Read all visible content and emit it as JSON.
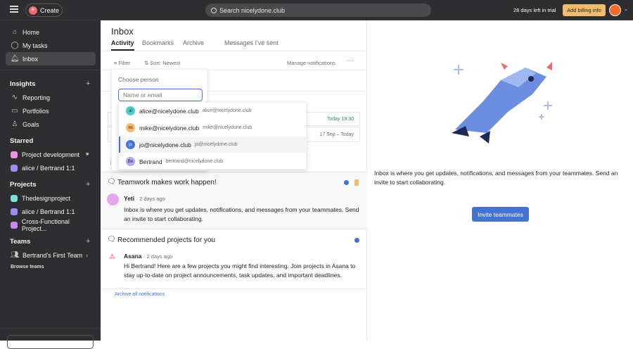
{
  "topbar": {
    "create_label": "Create",
    "search_placeholder": "Search nicelydone.club",
    "trial_text": "28 days left in trial",
    "billing_label": "Add billing info"
  },
  "sidebar": {
    "nav": [
      {
        "label": "Home"
      },
      {
        "label": "My tasks"
      },
      {
        "label": "Inbox"
      }
    ],
    "insights_label": "Insights",
    "insights": [
      {
        "label": "Reporting"
      },
      {
        "label": "Portfolios"
      },
      {
        "label": "Goals"
      }
    ],
    "starred_label": "Starred",
    "starred": [
      {
        "label": "Project development",
        "color": "#f28fe6"
      },
      {
        "label": "alice / Bertrand 1:1",
        "color": "#9f8cf2"
      }
    ],
    "projects_label": "Projects",
    "projects": [
      {
        "label": "Thedesignproject",
        "color": "#7fe0d6"
      },
      {
        "label": "alice / Bertrand 1:1",
        "color": "#9f8cf2"
      },
      {
        "label": "Cross-Functional Project...",
        "color": "#c58bef"
      }
    ],
    "teams_label": "Teams",
    "team": "Bertrand's First Team",
    "browse_teams": "Browse teams"
  },
  "main": {
    "title": "Inbox",
    "tabs": [
      "Activity",
      "Bookmarks",
      "Archive",
      "Messages I've sent"
    ],
    "filter_label": "Filter",
    "sort_label": "Sort: Newest",
    "manage_label": "Manage notifications",
    "task_dates": [
      "Today 19:30",
      "17 Sep – Today"
    ],
    "partial_label": "Pa",
    "notifications": [
      {
        "title": "Teamwork makes work happen!",
        "author": "Yeti",
        "time": "· 2 days ago",
        "body": "Inbox is where you get updates, notifications, and messages from your teammates. Send an invite to start collaborating."
      },
      {
        "title": "Recommended projects for you",
        "author": "Asana",
        "time": "· 2 days ago",
        "body": "Hi Bertrand! Here are a few projects you might find interesting. Join projects in Asana to stay up-to-date on project announcements, task updates, and important deadlines."
      }
    ],
    "archive_all": "Archive all notifications"
  },
  "person_picker": {
    "title": "Choose person",
    "placeholder": "Name or email",
    "options": [
      {
        "initials": "al",
        "name": "alice@nicelydone.club",
        "email": "alice@nicelydone.club",
        "color": "#4ecbc4"
      },
      {
        "initials": "mi",
        "name": "mike@nicelydone.club",
        "email": "mike@nicelydone.club",
        "color": "#f1bd6c"
      },
      {
        "initials": "jo",
        "name": "jo@nicelydone.club",
        "email": "jo@nicelydone.club",
        "color": "#4573d2"
      },
      {
        "initials": "Be",
        "name": "Bertrand",
        "email": "bertrand@nicelydone.club",
        "color": "#b9a6f5"
      }
    ]
  },
  "right": {
    "message": "Inbox is where you get updates, notifications, and messages from your teammates. Send an invite to start collaborating.",
    "invite_label": "Invite teammates"
  }
}
